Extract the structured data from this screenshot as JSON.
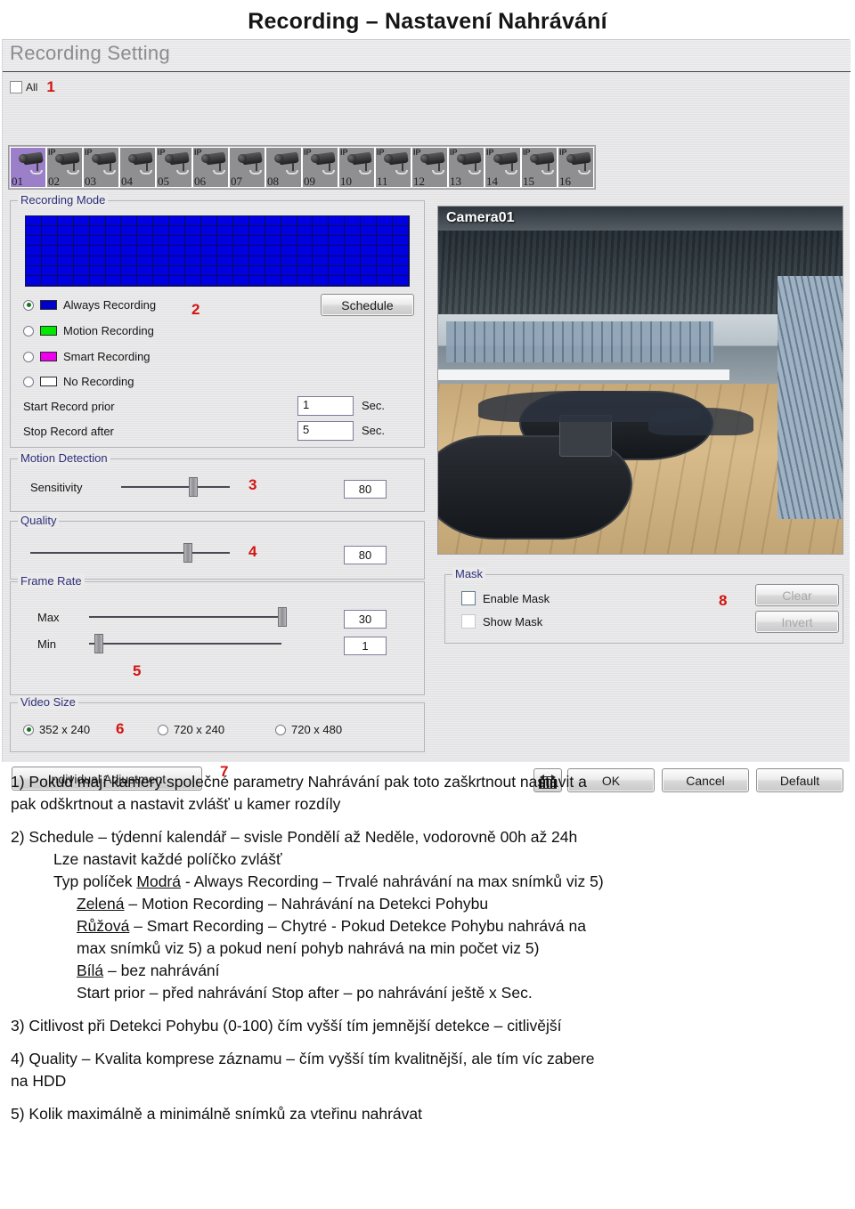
{
  "page": {
    "title": "Recording – Nastavení Nahrávání"
  },
  "window": {
    "header_title": "Recording Setting",
    "all_checkbox_label": "All",
    "marker_1": "1",
    "marker_2": "2",
    "marker_3": "3",
    "marker_4": "4",
    "marker_5": "5",
    "marker_6": "6",
    "marker_7": "7",
    "marker_8": "8"
  },
  "cameras": [
    {
      "num": "01",
      "ip": "",
      "selected": true
    },
    {
      "num": "02",
      "ip": "IP",
      "selected": false
    },
    {
      "num": "03",
      "ip": "IP",
      "selected": false
    },
    {
      "num": "04",
      "ip": "",
      "selected": false
    },
    {
      "num": "05",
      "ip": "IP",
      "selected": false
    },
    {
      "num": "06",
      "ip": "IP",
      "selected": false
    },
    {
      "num": "07",
      "ip": "",
      "selected": false
    },
    {
      "num": "08",
      "ip": "",
      "selected": false
    },
    {
      "num": "09",
      "ip": "IP",
      "selected": false
    },
    {
      "num": "10",
      "ip": "IP",
      "selected": false
    },
    {
      "num": "11",
      "ip": "IP",
      "selected": false
    },
    {
      "num": "12",
      "ip": "IP",
      "selected": false
    },
    {
      "num": "13",
      "ip": "IP",
      "selected": false
    },
    {
      "num": "14",
      "ip": "IP",
      "selected": false
    },
    {
      "num": "15",
      "ip": "IP",
      "selected": false
    },
    {
      "num": "16",
      "ip": "IP",
      "selected": false
    }
  ],
  "recording_mode": {
    "legend": "Recording Mode",
    "schedule_button": "Schedule",
    "schedule_grid": {
      "columns": 24,
      "rows": 7,
      "fill_color": "#0000e0",
      "fill_mode": "Always Recording"
    },
    "options": [
      {
        "label": "Always Recording",
        "color": "#0000cc",
        "selected": true
      },
      {
        "label": "Motion Recording",
        "color": "#00e800",
        "selected": false
      },
      {
        "label": "Smart Recording",
        "color": "#ee00ee",
        "selected": false
      },
      {
        "label": "No Recording",
        "color": "#ffffff",
        "selected": false
      }
    ],
    "start_record_prior": {
      "label": "Start Record prior",
      "value": "1",
      "unit": "Sec."
    },
    "stop_record_after": {
      "label": "Stop Record after",
      "value": "5",
      "unit": "Sec."
    }
  },
  "motion_detection": {
    "legend": "Motion Detection",
    "sensitivity": {
      "label": "Sensitivity",
      "value": "80",
      "percent": 62
    }
  },
  "quality": {
    "legend": "Quality",
    "value": "80",
    "percent": 77
  },
  "frame_rate": {
    "legend": "Frame Rate",
    "max": {
      "label": "Max",
      "value": "30",
      "percent": 98
    },
    "min": {
      "label": "Min",
      "value": "1",
      "percent": 3
    }
  },
  "video_size": {
    "legend": "Video Size",
    "options": [
      {
        "label": "352 x 240",
        "selected": true
      },
      {
        "label": "720 x 240",
        "selected": false
      },
      {
        "label": "720 x 480",
        "selected": false
      }
    ]
  },
  "individual_adjustment_button": "Individual Adjustment",
  "preview": {
    "caption": "Camera01"
  },
  "mask": {
    "legend": "Mask",
    "enable_mask": {
      "label": "Enable Mask",
      "checked": false
    },
    "show_mask": {
      "label": "Show Mask",
      "checked": false
    },
    "clear_button": "Clear",
    "invert_button": "Invert"
  },
  "footer_buttons": {
    "ok": "OK",
    "cancel": "Cancel",
    "default": "Default",
    "keyboard_icon": "virtual-keyboard"
  },
  "notes": {
    "n1_l1": "1) Pokud mají kamery společné parametry Nahrávání pak toto zaškrtnout nastavit a",
    "n1_l2": "pak odškrtnout a nastavit zvlášť u kamer rozdíly",
    "n2_l1": "2) Schedule – týdenní kalendář – svisle Pondělí až Neděle, vodorovně 00h až 24h",
    "n2_l2": "Lze nastavit každé políčko zvlášť",
    "n2_l3_a": "Typ políček ",
    "n2_l3_u": "Modrá",
    "n2_l3_b": " - Always Recording – Trvalé nahrávání na max snímků viz 5)",
    "n2_l4_u": "Zelená",
    "n2_l4_b": " – Motion Recording – Nahrávání na Detekci Pohybu",
    "n2_l5_u": "Růžová",
    "n2_l5_b": " – Smart Recording – Chytré - Pokud Detekce Pohybu nahrává na",
    "n2_l6": "max snímků viz 5) a pokud není pohyb nahrává na min počet viz 5)",
    "n2_l7_u": "Bílá",
    "n2_l7_b": " – bez nahrávání",
    "n2_l8": "Start prior – před nahrávání    Stop after – po nahrávání ještě  x Sec.",
    "n3": "3) Citlivost při Detekci Pohybu (0-100) čím vyšší tím jemnější detekce – citlivější",
    "n4_l1": "4) Quality – Kvalita komprese záznamu – čím vyšší tím kvalitnější, ale tím víc zabere",
    "n4_l2": "na HDD",
    "n5": "5) Kolik maximálně a minimálně snímků za vteřinu nahrávat"
  }
}
